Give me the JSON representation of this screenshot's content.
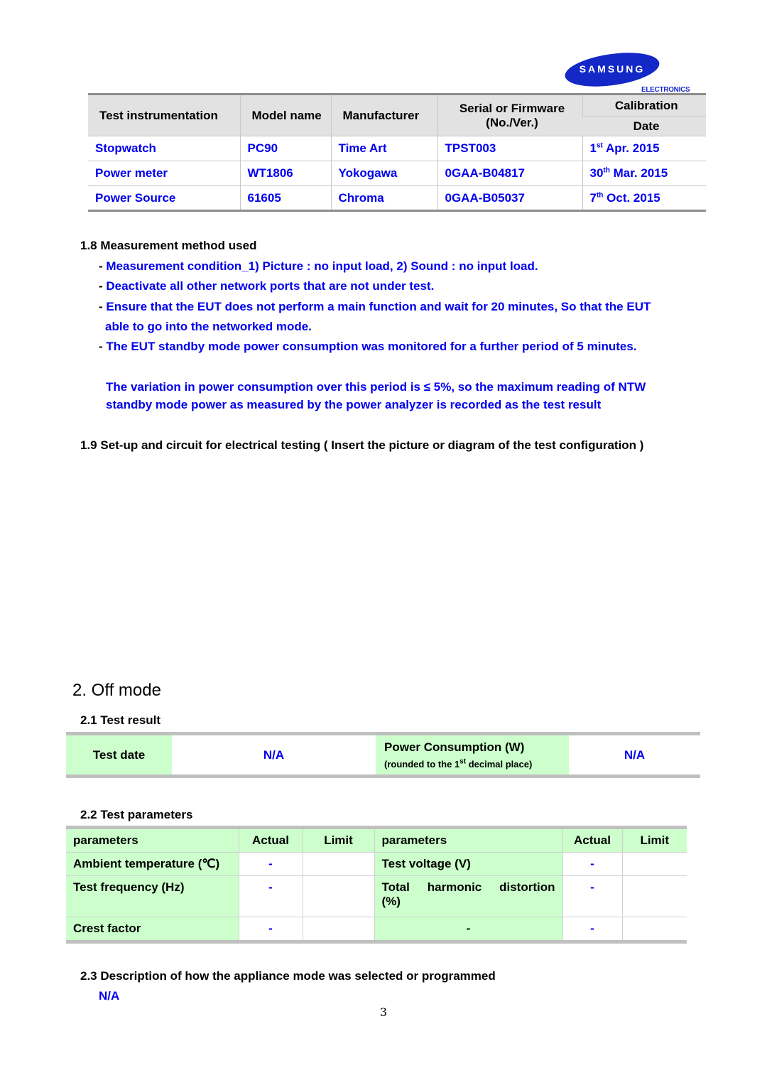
{
  "logo": {
    "brand": "SAMSUNG",
    "sub": "ELECTRONICS"
  },
  "instrumentation_table": {
    "headers": {
      "instrument": "Test instrumentation",
      "model": "Model name",
      "manufacturer": "Manufacturer",
      "serial_line1": "Serial or Firmware",
      "serial_line2": "(No./Ver.)",
      "calibration": "Calibration",
      "date": "Date"
    },
    "rows": [
      {
        "instrument": "Stopwatch",
        "model": "PC90",
        "manufacturer": "Time Art",
        "serial": "TPST003",
        "cal_day": "1",
        "cal_suffix": "st",
        "cal_rest": " Apr. 2015"
      },
      {
        "instrument": "Power meter",
        "model": "WT1806",
        "manufacturer": "Yokogawa",
        "serial": "0GAA-B04817",
        "cal_day": "30",
        "cal_suffix": "th",
        "cal_rest": " Mar. 2015"
      },
      {
        "instrument": "Power Source",
        "model": "61605",
        "manufacturer": "Chroma",
        "serial": "0GAA-B05037",
        "cal_day": "7",
        "cal_suffix": "th",
        "cal_rest": " Oct. 2015"
      }
    ]
  },
  "section_1_8": {
    "heading": "1.8 Measurement method used",
    "bullets": [
      "Measurement condition_1) Picture : no input load, 2) Sound : no input load.",
      "Deactivate all other network ports that are not under test.",
      "Ensure that the EUT does not perform a main function and wait for 20 minutes, So that the EUT",
      "The EUT standby mode power consumption was monitored for a further period of 5 minutes."
    ],
    "bullet3_cont": "able to go into the networked mode.",
    "variation_line1": "The variation in power consumption over this period is  ≤  5%, so the maximum reading of NTW",
    "variation_line2": "standby mode power as measured by the power analyzer is recorded as the test result"
  },
  "section_1_9": {
    "heading": "1.9 Set-up and circuit for electrical testing ( Insert the picture or diagram of the test configuration )"
  },
  "off_mode": {
    "title": "2. Off mode",
    "test_result": {
      "heading": "2.1 Test result",
      "test_date_label": "Test date",
      "test_date_value": "N/A",
      "power_label": "Power Consumption (W)",
      "power_note_pre": "(rounded to the 1",
      "power_note_sup": "st",
      "power_note_post": " decimal place)",
      "power_value": "N/A"
    },
    "test_parameters": {
      "heading": "2.2 Test parameters",
      "headers": [
        "parameters",
        "Actual",
        "Limit",
        "parameters",
        "Actual",
        "Limit"
      ],
      "rows": [
        {
          "p1": "Ambient temperature (℃)",
          "a1": "-",
          "l1": "",
          "p2": "Test voltage (V)",
          "a2": "-",
          "l2": ""
        },
        {
          "p1": "Test frequency (Hz)",
          "a1": "-",
          "l1": "",
          "p2": "Total harmonic distortion (%)",
          "a2": "-",
          "l2": ""
        },
        {
          "p1": "Crest factor",
          "a1": "-",
          "l1": "",
          "p2": "-",
          "a2": "-",
          "l2": ""
        }
      ]
    },
    "description": {
      "heading": "2.3 Description of how the appliance mode was selected or programmed",
      "value": "N/A"
    }
  },
  "page_number": "3"
}
